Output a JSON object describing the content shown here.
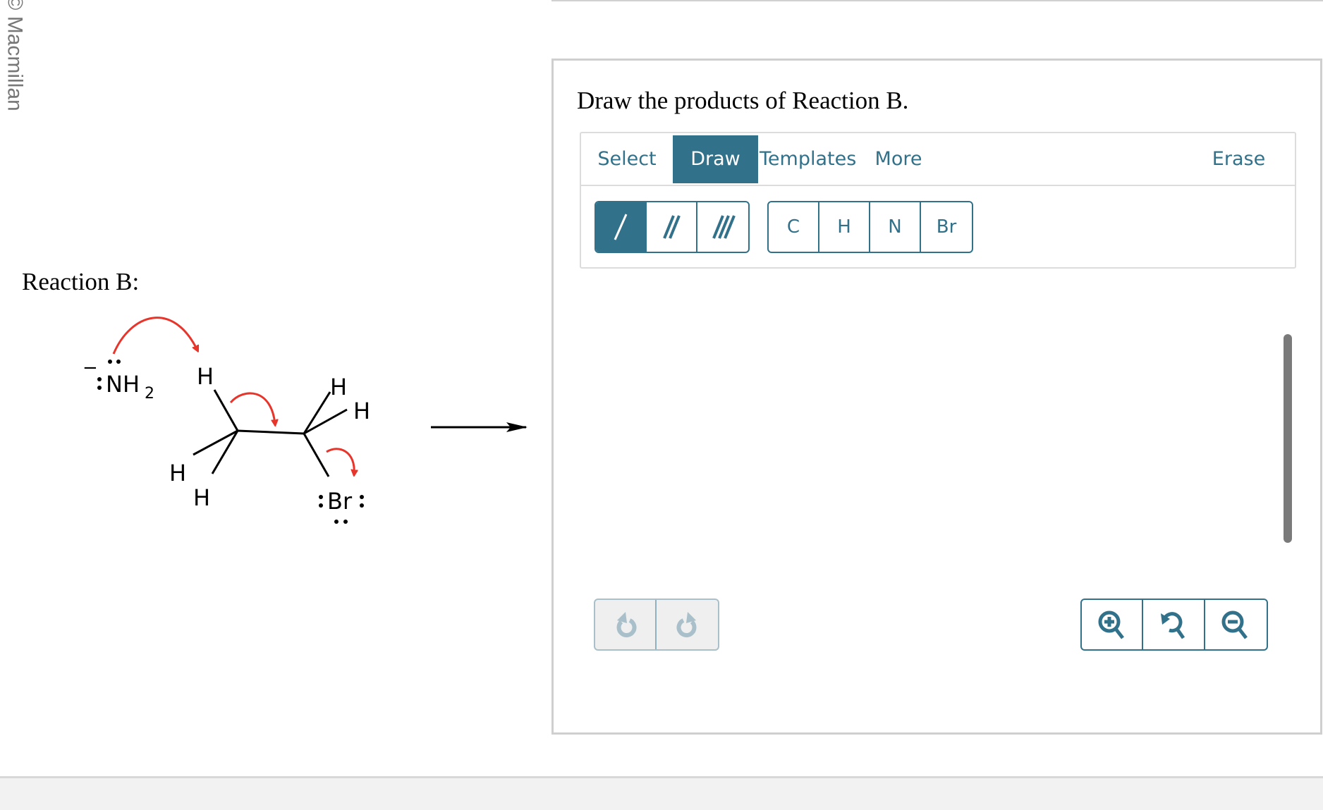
{
  "watermark": "© Macmillan",
  "reaction": {
    "label": "Reaction B:",
    "nucleophile": {
      "charge": "−",
      "atom": "NH",
      "subscript": "2"
    },
    "substrate_atoms": {
      "h_top_left": "H",
      "h_left": "H",
      "h_bottom": "H",
      "h_top_right": "H",
      "h_right": "H",
      "leaving_group": "Br"
    },
    "arrow_color": "#e8352b"
  },
  "question": {
    "title": "Draw the products of Reaction B."
  },
  "toolbar": {
    "tabs": [
      {
        "label": "Select",
        "active": false
      },
      {
        "label": "Draw",
        "active": true
      },
      {
        "label": "Templates",
        "active": false
      },
      {
        "label": "More",
        "active": false
      }
    ],
    "erase_label": "Erase",
    "bonds": [
      {
        "icon": "single-bond-icon",
        "active": true
      },
      {
        "icon": "double-bond-icon",
        "active": false
      },
      {
        "icon": "triple-bond-icon",
        "active": false
      }
    ],
    "atoms": [
      "C",
      "H",
      "N",
      "Br"
    ]
  },
  "history": [
    {
      "icon": "undo-icon",
      "enabled": false
    },
    {
      "icon": "redo-icon",
      "enabled": false
    }
  ],
  "zoom": [
    {
      "icon": "zoom-in-icon"
    },
    {
      "icon": "zoom-reset-icon"
    },
    {
      "icon": "zoom-out-icon"
    }
  ],
  "colors": {
    "accent": "#32718a",
    "disabled": "#a9c0ca",
    "curved_arrow": "#e8352b"
  }
}
